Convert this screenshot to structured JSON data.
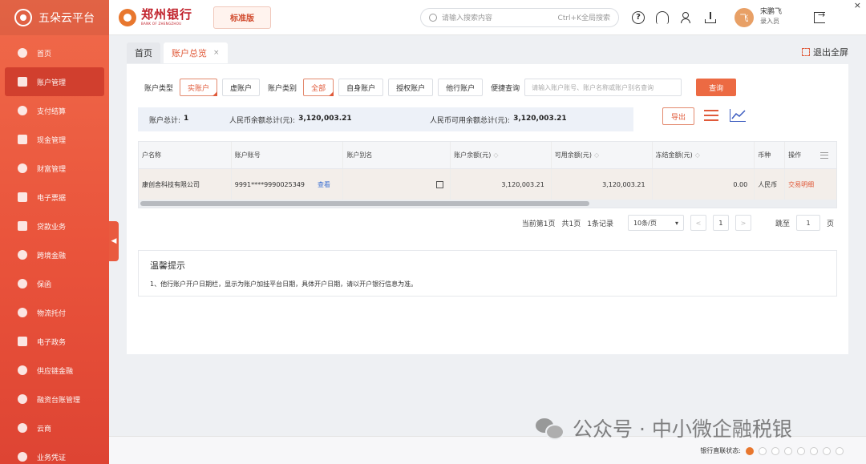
{
  "app": {
    "platform_name": "五朵云平台",
    "close_glyph": "×"
  },
  "header": {
    "bank_name": "郑州银行",
    "bank_name_en": "BANK OF ZHENGZHOU",
    "edition": "标准版",
    "search_placeholder": "请输入搜索内容",
    "search_shortcut": "Ctrl+K全局搜索",
    "help_glyph": "?",
    "user": {
      "avatar_text": "飞",
      "name": "宋鹏飞",
      "role": "录入员"
    }
  },
  "sidebar": {
    "collapse_glyph": "◀",
    "items": [
      {
        "label": "首页",
        "icon": "home-icon",
        "active": false
      },
      {
        "label": "账户管理",
        "icon": "account-icon",
        "active": true
      },
      {
        "label": "支付结算",
        "icon": "payment-icon",
        "active": false
      },
      {
        "label": "现金管理",
        "icon": "cash-icon",
        "active": false
      },
      {
        "label": "财富管理",
        "icon": "wealth-icon",
        "active": false
      },
      {
        "label": "电子票据",
        "icon": "bill-icon",
        "active": false
      },
      {
        "label": "贷款业务",
        "icon": "loan-icon",
        "active": false
      },
      {
        "label": "跨境金融",
        "icon": "crossborder-icon",
        "active": false
      },
      {
        "label": "保函",
        "icon": "guarantee-icon",
        "active": false
      },
      {
        "label": "物流托付",
        "icon": "logistics-icon",
        "active": false
      },
      {
        "label": "电子政务",
        "icon": "egov-icon",
        "active": false
      },
      {
        "label": "供应链金融",
        "icon": "supplychain-icon",
        "active": false
      },
      {
        "label": "融资台账管理",
        "icon": "ledger-icon",
        "active": false
      },
      {
        "label": "云商",
        "icon": "cloud-icon",
        "active": false
      },
      {
        "label": "业务凭证",
        "icon": "voucher-icon",
        "active": false
      }
    ]
  },
  "tabs": [
    {
      "label": "首页",
      "active": false,
      "closable": false
    },
    {
      "label": "账户总览",
      "active": true,
      "closable": true,
      "close_glyph": "×"
    }
  ],
  "fullscreen_label": "退出全屏",
  "filters": {
    "account_type_label": "账户类型",
    "account_types": [
      {
        "label": "实账户",
        "selected": true
      },
      {
        "label": "虚账户",
        "selected": false
      }
    ],
    "account_category_label": "账户类别",
    "account_categories": [
      {
        "label": "全部",
        "selected": true
      },
      {
        "label": "自身账户",
        "selected": false
      },
      {
        "label": "授权账户",
        "selected": false
      },
      {
        "label": "他行账户",
        "selected": false
      }
    ],
    "quick_query_label": "便捷查询",
    "query_placeholder": "请输入账户账号、账户名称或账户别名查询",
    "query_button": "查询"
  },
  "summary": {
    "total_label": "账户总计:",
    "total_value": "1",
    "rmb_balance_label": "人民币余额总计(元):",
    "rmb_balance_value": "3,120,003.21",
    "rmb_available_label": "人民币可用余额总计(元):",
    "rmb_available_value": "3,120,003.21",
    "export_button": "导出"
  },
  "table": {
    "sort_glyph": "◇",
    "columns": [
      "户名称",
      "账户账号",
      "账户别名",
      "账户余额(元)",
      "可用余额(元)",
      "冻结金额(元)",
      "币种",
      "操作"
    ],
    "rows": [
      {
        "name": "康创舍科技有限公司",
        "account_no": "9991****9990025349",
        "view_link": "查看",
        "alias": "",
        "balance": "3,120,003.21",
        "available": "3,120,003.21",
        "frozen": "0.00",
        "currency": "人民币",
        "action": "交易明细"
      }
    ]
  },
  "pagination": {
    "current_page_text": "当前第1页",
    "total_pages_text": "共1页",
    "total_records_text": "1条记录",
    "page_size": "10条/页",
    "page_size_glyph": "▾",
    "prev_glyph": "<",
    "next_glyph": ">",
    "current_page": "1",
    "goto_label": "跳至",
    "goto_value": "1",
    "page_unit": "页"
  },
  "tips": {
    "title": "温馨提示",
    "text": "1、他行账户开户日期栏，显示为账户加挂平台日期，具体开户日期，请以开户银行信息为准。"
  },
  "footer": {
    "bank_link_status_label": "银行直联状态:"
  },
  "watermark": {
    "text": "公众号 · 中小微企融税银"
  },
  "colors": {
    "accent": "#e05a3a",
    "sidebar": "#e9533b",
    "link": "#3b6fd1",
    "summary_bg": "#edf1f8"
  }
}
